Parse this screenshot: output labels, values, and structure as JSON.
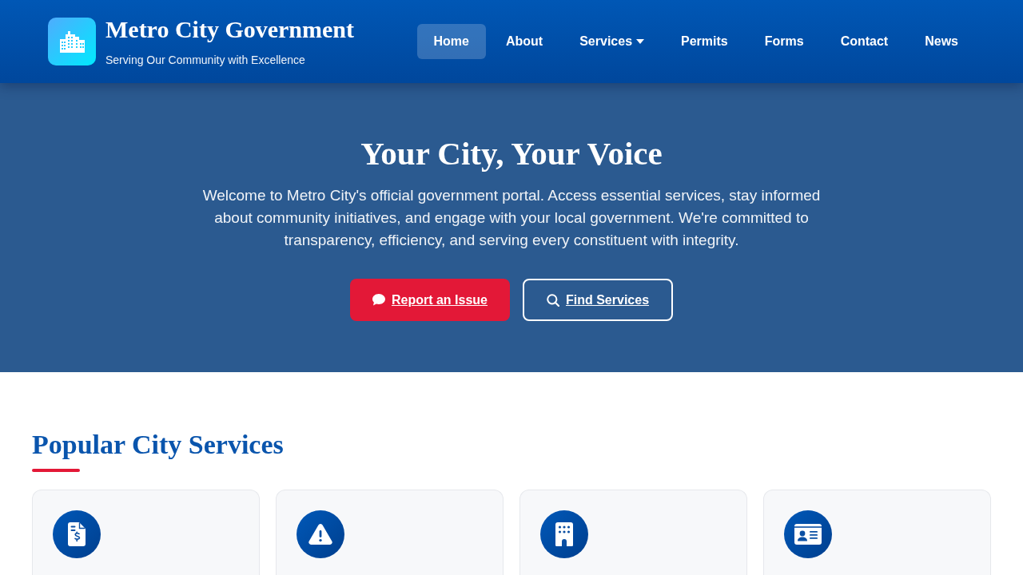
{
  "header": {
    "title": "Metro City Government",
    "tagline": "Serving Our Community with Excellence"
  },
  "nav": [
    {
      "label": "Home",
      "selected": true,
      "dropdown": false
    },
    {
      "label": "About",
      "selected": false,
      "dropdown": false
    },
    {
      "label": "Services",
      "selected": false,
      "dropdown": true
    },
    {
      "label": "Permits",
      "selected": false,
      "dropdown": false
    },
    {
      "label": "Forms",
      "selected": false,
      "dropdown": false
    },
    {
      "label": "Contact",
      "selected": false,
      "dropdown": false
    },
    {
      "label": "News",
      "selected": false,
      "dropdown": false
    }
  ],
  "hero": {
    "title": "Your City, Your Voice",
    "text": "Welcome to Metro City's official government portal. Access essential services, stay informed about community initiatives, and engage with your local government. We're committed to transparency, efficiency, and serving every constituent with integrity.",
    "buttons": [
      {
        "label": "Report an Issue",
        "kind": "primary"
      },
      {
        "label": "Find Services",
        "kind": "outline"
      }
    ]
  },
  "services": {
    "title": "Popular City Services",
    "cards": [
      {
        "kind": "billing"
      },
      {
        "kind": "hazard"
      },
      {
        "kind": "building"
      },
      {
        "kind": "identity"
      }
    ]
  }
}
